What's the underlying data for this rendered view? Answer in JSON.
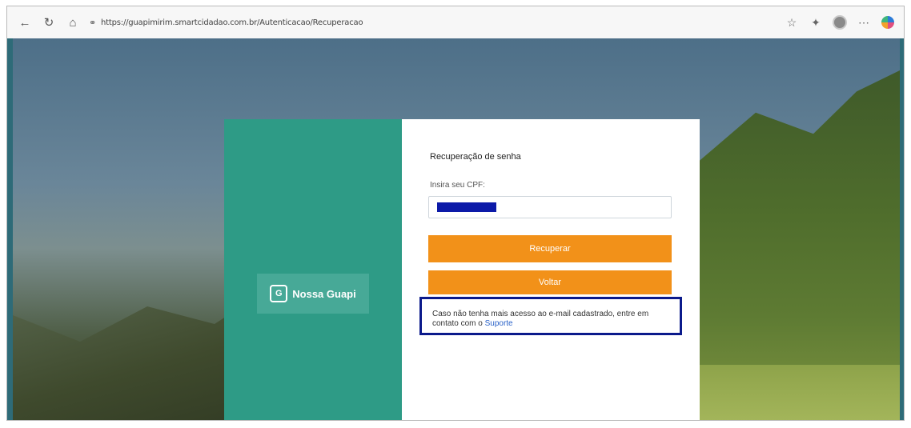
{
  "browser": {
    "address_url": "https://guapimirim.smartcidadao.com.br/Autenticacao/Recuperacao"
  },
  "brand": {
    "name": "Nossa Guapi"
  },
  "form": {
    "title": "Recuperação de senha",
    "cpf_label": "Insira seu CPF:",
    "recover_label": "Recuperar",
    "back_label": "Voltar",
    "hint_text": "Caso não tenha mais acesso ao e-mail cadastrado, entre em contato com o ",
    "support_link": "Suporte"
  },
  "colors": {
    "accent_orange": "#f29119",
    "brand_teal": "#2e9b86",
    "highlight_navy": "#0b1a8b",
    "link_blue": "#2a62c8"
  }
}
